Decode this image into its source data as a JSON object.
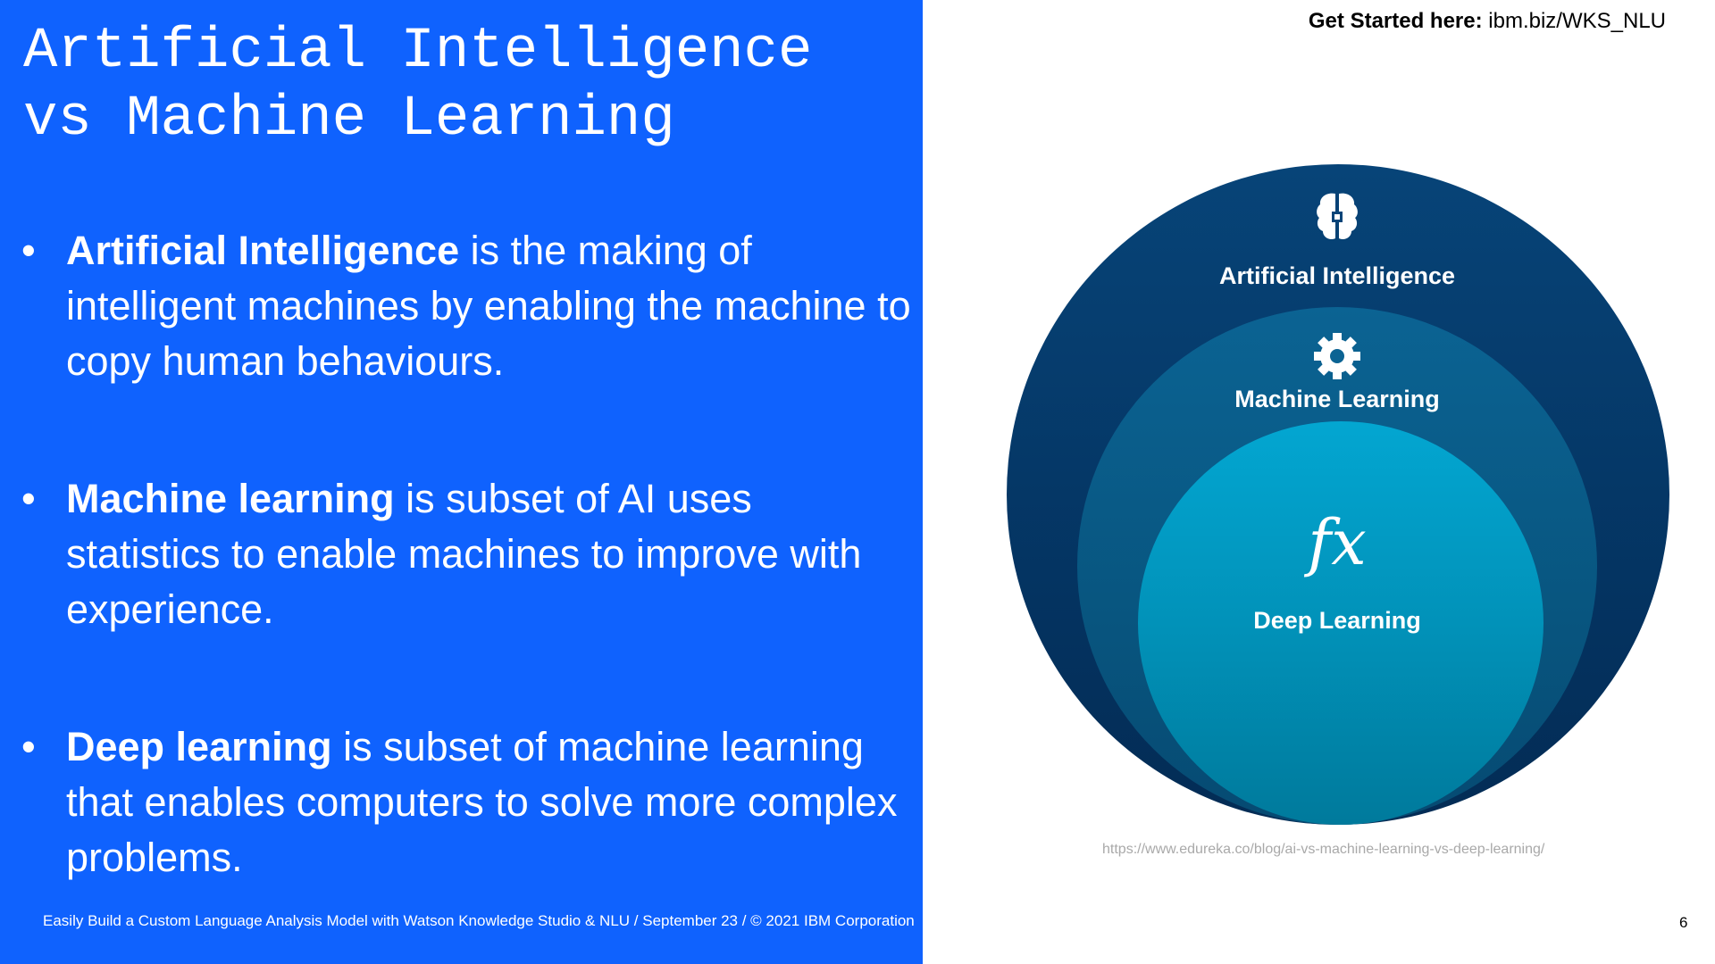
{
  "slide": {
    "title_line1": "Artificial Intelligence",
    "title_line2": "vs Machine Learning",
    "bullets": [
      {
        "term": "Artificial Intelligence",
        "text": " is the making of intelligent machines by enabling the machine to copy human behaviours."
      },
      {
        "term": "Machine learning",
        "text": " is subset of AI uses statistics to enable machines to improve with experience."
      },
      {
        "term": "Deep learning",
        "text": " is subset of machine learning that enables computers to solve more complex problems."
      }
    ],
    "footer": "Easily Build a Custom Language Analysis Model with Watson Knowledge Studio & NLU / September 23 / © 2021 IBM Corporation",
    "page_number": "6"
  },
  "header": {
    "get_started_label": "Get Started here:",
    "get_started_link": "ibm.biz/WKS_NLU"
  },
  "diagram": {
    "outer_label": "Artificial Intelligence",
    "middle_label": "Machine Learning",
    "inner_label": "Deep Learning",
    "outer_icon": "brain-chip-icon",
    "middle_icon": "gear-icon",
    "inner_icon": "function-fx-icon",
    "fx_glyph": "fx",
    "colors": {
      "outer": "#074478",
      "middle": "#0b6393",
      "inner": "#03a6d1",
      "panel": "#0f62fe"
    }
  },
  "source_url": "https://www.edureka.co/blog/ai-vs-machine-learning-vs-deep-learning/"
}
